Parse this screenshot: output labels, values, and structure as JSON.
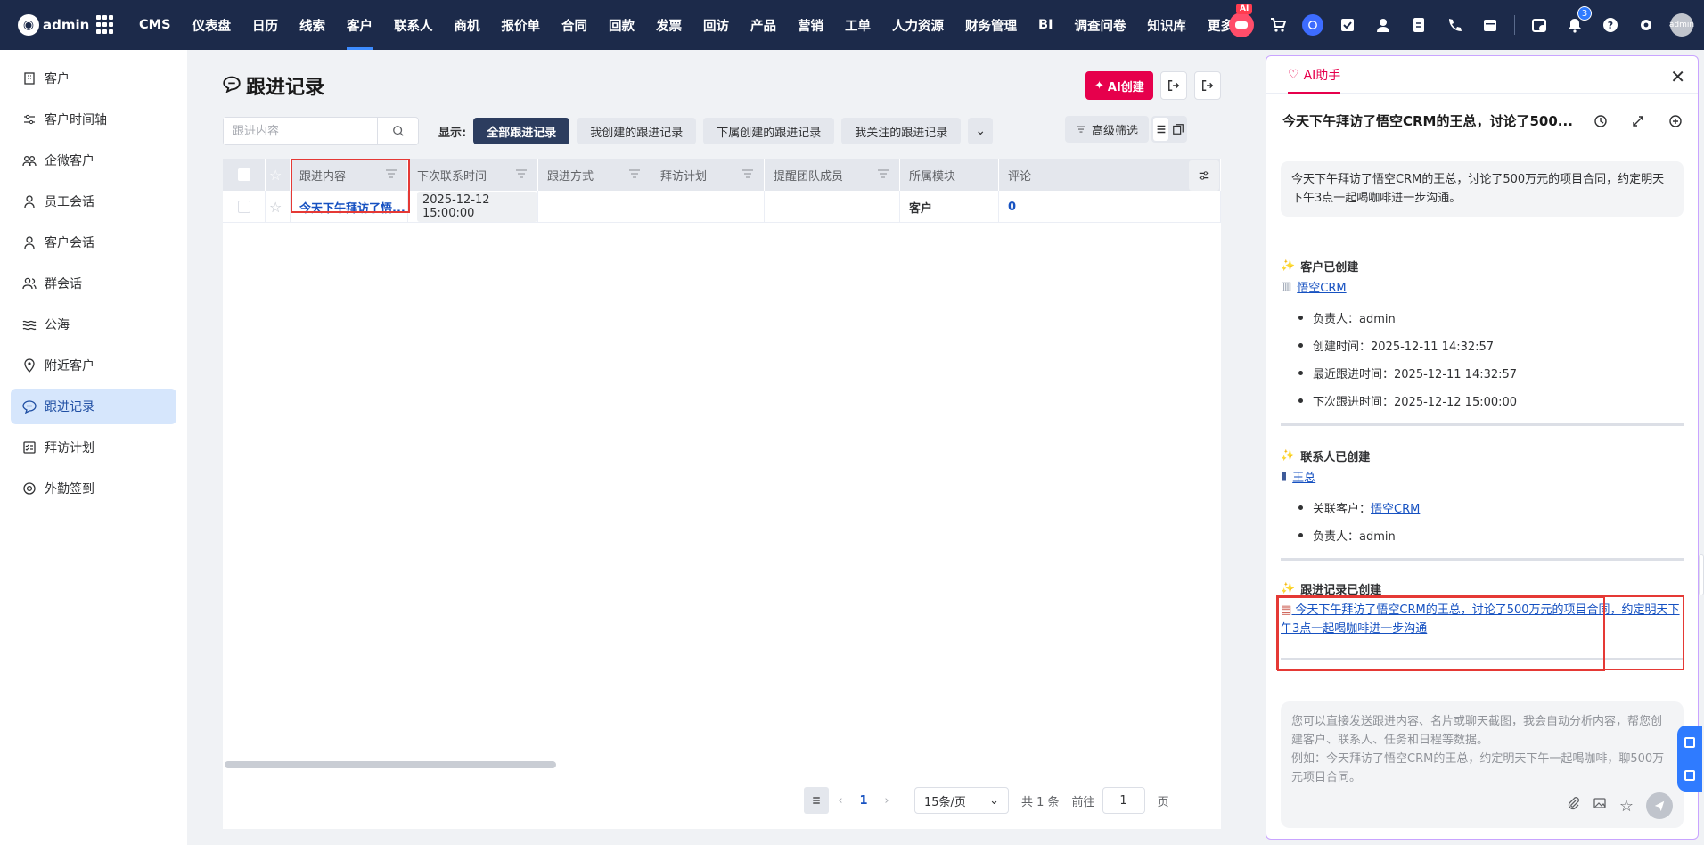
{
  "topbar": {
    "app_name": "admin",
    "nav": [
      "CMS",
      "仪表盘",
      "日历",
      "线索",
      "客户",
      "联系人",
      "商机",
      "报价单",
      "合同",
      "回款",
      "发票",
      "回访",
      "产品",
      "营销",
      "工单",
      "人力资源",
      "财务管理",
      "BI",
      "调查问卷",
      "知识库"
    ],
    "active_nav": "客户",
    "more_label": "更多",
    "ai_tag": "AI",
    "notification_count": "3",
    "avatar_label": "admin"
  },
  "sidebar": {
    "items": [
      {
        "label": "客户",
        "icon": "building-icon"
      },
      {
        "label": "客户时间轴",
        "icon": "timeline-icon"
      },
      {
        "label": "企微客户",
        "icon": "wecom-users-icon"
      },
      {
        "label": "员工会话",
        "icon": "staff-chat-icon"
      },
      {
        "label": "客户会话",
        "icon": "customer-chat-icon"
      },
      {
        "label": "群会话",
        "icon": "group-chat-icon"
      },
      {
        "label": "公海",
        "icon": "waves-icon"
      },
      {
        "label": "附近客户",
        "icon": "location-pin-icon"
      },
      {
        "label": "跟进记录",
        "icon": "chat-bubble-icon"
      },
      {
        "label": "拜访计划",
        "icon": "checklist-icon"
      },
      {
        "label": "外勤签到",
        "icon": "target-icon"
      }
    ],
    "active_index": 8
  },
  "page": {
    "title": "跟进记录",
    "ai_create_label": "AI创建",
    "search_placeholder": "跟进内容",
    "show_label": "显示:",
    "segments": [
      "全部跟进记录",
      "我创建的跟进记录",
      "下属创建的跟进记录",
      "我关注的跟进记录"
    ],
    "active_segment": 0,
    "advanced_filter_label": "高级筛选"
  },
  "table": {
    "columns": [
      "跟进内容",
      "下次联系时间",
      "跟进方式",
      "拜访计划",
      "提醒团队成员",
      "所属模块",
      "评论"
    ],
    "rows": [
      {
        "content": "今天下午拜访了悟...",
        "next_contact": "2025-12-12 15:00:00",
        "method": "",
        "visit_plan": "",
        "remind": "",
        "module": "客户",
        "comments": "0"
      }
    ]
  },
  "pagination": {
    "current": "1",
    "page_size": "15条/页",
    "total": "共 1 条",
    "goto_label": "前往",
    "goto_value": "1",
    "page_suffix": "页"
  },
  "ai_panel": {
    "tab_label": "AI助手",
    "conversation_title": "今天下午拜访了悟空CRM的王总，讨论了500...",
    "user_message": "今天下午拜访了悟空CRM的王总，讨论了500万元的项目合同，约定明天下午3点一起喝咖啡进一步沟通。",
    "customer_card": {
      "heading": "客户已创建",
      "link": "悟空CRM",
      "fields": [
        "负责人：admin",
        "创建时间：2025-12-11 14:32:57",
        "最近跟进时间：2025-12-11 14:32:57",
        "下次跟进时间：2025-12-12 15:00:00"
      ]
    },
    "contact_card": {
      "heading": "联系人已创建",
      "link": "王总",
      "field_related_label": "关联客户：",
      "field_related_link": "悟空CRM",
      "field_owner": "负责人：admin"
    },
    "record_card": {
      "heading": "跟进记录已创建",
      "link": "今天下午拜访了悟空CRM的王总，讨论了500万元的项目合同，约定明天下午3点一起喝咖啡进一步沟通"
    },
    "input_placeholder_1": "您可以直接发送跟进内容、名片或聊天截图，我会自动分析内容，帮您创建客户、联系人、任务和日程等数据。",
    "input_placeholder_2": "例如：今天拜访了悟空CRM的王总，约定明天下午一起喝咖啡，聊500万元项目合同。"
  },
  "colors": {
    "topbar": "#1c2a4a",
    "accent_red": "#e6004c",
    "link_blue": "#1651c1",
    "highlight_red": "#e53935"
  }
}
